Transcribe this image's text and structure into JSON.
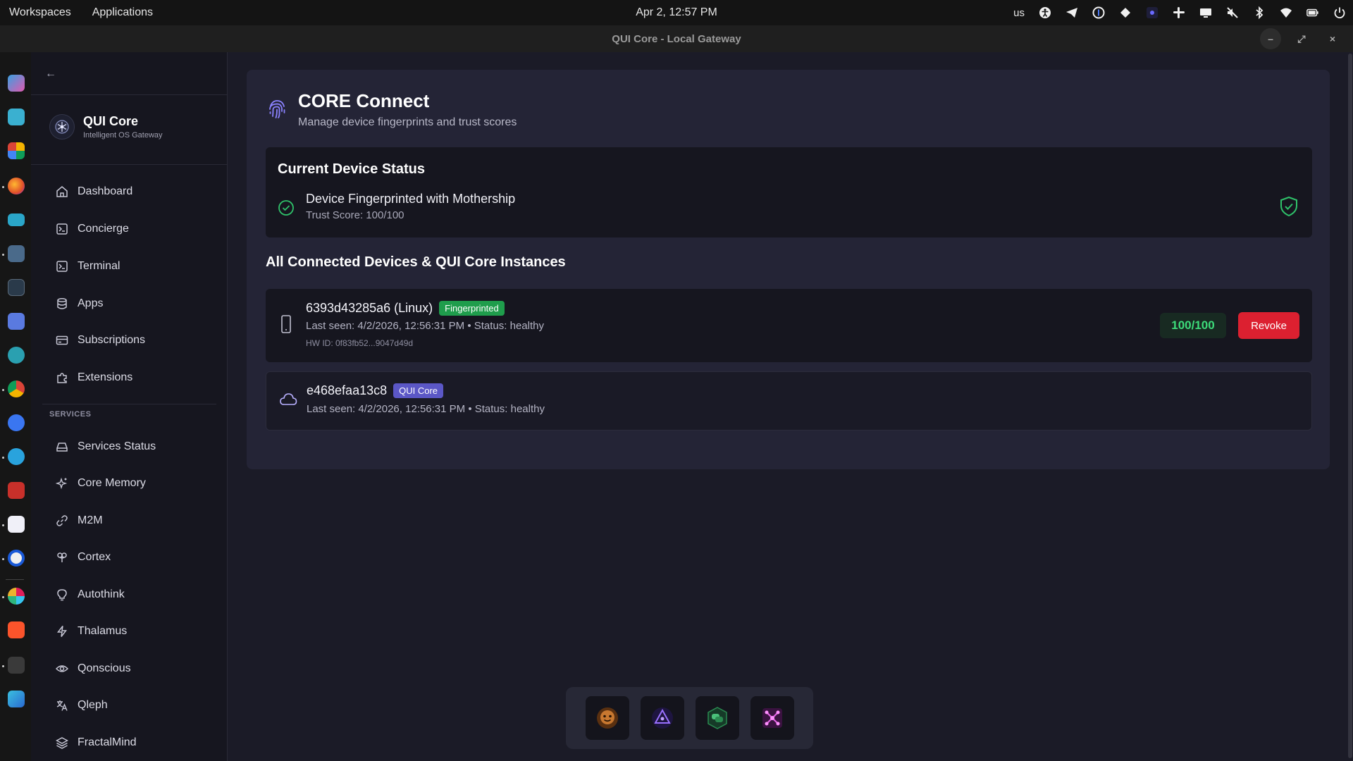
{
  "topbar": {
    "workspaces": "Workspaces",
    "applications": "Applications",
    "clock": "Apr 2, 12:57 PM",
    "keyboard_layout": "us",
    "tray_icons": [
      "accessibility-icon",
      "telegram-icon",
      "password-manager-icon",
      "diamond-icon",
      "app-indicator-icon",
      "slack-icon",
      "display-icon",
      "mute-icon",
      "bluetooth-icon",
      "wifi-icon",
      "battery-icon",
      "power-icon"
    ]
  },
  "window": {
    "title": "QUI Core - Local Gateway",
    "minimize": "–",
    "maximize": "⤢",
    "close": "×"
  },
  "dock": {
    "apps": [
      "search-app",
      "dashboard-app",
      "app-grid",
      "firefox",
      "files",
      "text-editor",
      "terminal",
      "toolbox",
      "cursor",
      "chrome",
      "signal",
      "telegram",
      "screen-recorder",
      "mail",
      "password-manager",
      "slack",
      "brave",
      "settings",
      "image-viewer"
    ]
  },
  "sidebar": {
    "back_glyph": "←",
    "brand_name": "QUI Core",
    "brand_tagline": "Intelligent OS Gateway",
    "items": [
      {
        "label": "Dashboard",
        "icon": "home-icon"
      },
      {
        "label": "Concierge",
        "icon": "terminal-box-icon"
      },
      {
        "label": "Terminal",
        "icon": "terminal-box-icon"
      },
      {
        "label": "Apps",
        "icon": "database-icon"
      },
      {
        "label": "Subscriptions",
        "icon": "card-icon"
      },
      {
        "label": "Extensions",
        "icon": "puzzle-icon"
      }
    ],
    "services_label": "SERVICES",
    "services": [
      {
        "label": "Services Status",
        "icon": "hard-drive-icon"
      },
      {
        "label": "Core Memory",
        "icon": "sparkles-icon"
      },
      {
        "label": "M2M",
        "icon": "link-icon"
      },
      {
        "label": "Cortex",
        "icon": "brain-icon"
      },
      {
        "label": "Autothink",
        "icon": "lightbulb-icon"
      },
      {
        "label": "Thalamus",
        "icon": "zap-icon"
      },
      {
        "label": "Qonscious",
        "icon": "eye-icon"
      },
      {
        "label": "Qleph",
        "icon": "languages-icon"
      },
      {
        "label": "FractalMind",
        "icon": "layers-icon"
      }
    ]
  },
  "page": {
    "title": "CORE Connect",
    "subtitle": "Manage device fingerprints and trust scores",
    "status": {
      "heading": "Current Device Status",
      "message": "Device Fingerprinted with Mothership",
      "trust": "Trust Score: 100/100"
    },
    "devices_heading": "All Connected Devices & QUI Core Instances",
    "devices": [
      {
        "name": "6393d43285a6 (Linux)",
        "badge": "Fingerprinted",
        "seen": "Last seen: 4/2/2026, 12:56:31 PM • Status: healthy",
        "hw": "HW ID: 0f83fb52...9047d49d",
        "score": "100/100",
        "action": "Revoke"
      },
      {
        "name": "e468efaa13c8",
        "badge": "QUI Core",
        "seen": "Last seen: 4/2/2026, 12:56:31 PM • Status: healthy"
      }
    ]
  },
  "launcher": {
    "apps": [
      "emoji-app",
      "triangle-app",
      "chat-app",
      "network-app"
    ]
  },
  "colors": {
    "accent": "#8b82ff",
    "success": "#1f9d4c",
    "danger": "#dc2030",
    "qui_badge": "#5b57c6"
  }
}
